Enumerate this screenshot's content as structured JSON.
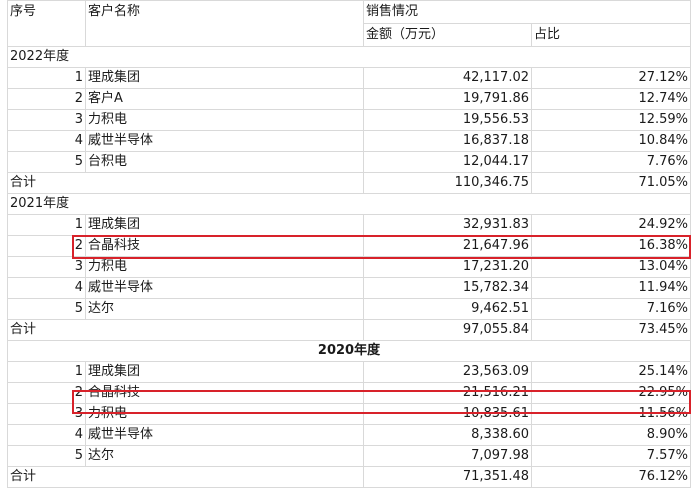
{
  "header": {
    "seq": "序号",
    "customer": "客户名称",
    "sales": "销售情况",
    "amount": "金额（万元）",
    "ratio": "占比"
  },
  "sections": [
    {
      "year": "2022年度",
      "rows": [
        {
          "no": "1",
          "name": "理成集团",
          "amount": "42,117.02",
          "ratio": "27.12%"
        },
        {
          "no": "2",
          "name": "客户A",
          "amount": "19,791.86",
          "ratio": "12.74%"
        },
        {
          "no": "3",
          "name": "力积电",
          "amount": "19,556.53",
          "ratio": "12.59%"
        },
        {
          "no": "4",
          "name": "威世半导体",
          "amount": "16,837.18",
          "ratio": "10.84%"
        },
        {
          "no": "5",
          "name": "台积电",
          "amount": "12,044.17",
          "ratio": "7.76%"
        }
      ],
      "total": {
        "label": "合计",
        "amount": "110,346.75",
        "ratio": "71.05%"
      }
    },
    {
      "year": "2021年度",
      "rows": [
        {
          "no": "1",
          "name": "理成集团",
          "amount": "32,931.83",
          "ratio": "24.92%"
        },
        {
          "no": "2",
          "name": "合晶科技",
          "amount": "21,647.96",
          "ratio": "16.38%"
        },
        {
          "no": "3",
          "name": "力积电",
          "amount": "17,231.20",
          "ratio": "13.04%"
        },
        {
          "no": "4",
          "name": "威世半导体",
          "amount": "15,782.34",
          "ratio": "11.94%"
        },
        {
          "no": "5",
          "name": "达尔",
          "amount": "9,462.51",
          "ratio": "7.16%"
        }
      ],
      "total": {
        "label": "合计",
        "amount": "97,055.84",
        "ratio": "73.45%"
      }
    },
    {
      "year": "2020年度",
      "rows": [
        {
          "no": "1",
          "name": "理成集团",
          "amount": "23,563.09",
          "ratio": "25.14%"
        },
        {
          "no": "2",
          "name": "合晶科技",
          "amount": "21,516.21",
          "ratio": "22.95%"
        },
        {
          "no": "3",
          "name": "力积电",
          "amount": "10,835.61",
          "ratio": "11.56%"
        },
        {
          "no": "4",
          "name": "威世半导体",
          "amount": "8,338.60",
          "ratio": "8.90%"
        },
        {
          "no": "5",
          "name": "达尔",
          "amount": "7,097.98",
          "ratio": "7.57%"
        }
      ],
      "total": {
        "label": "合计",
        "amount": "71,351.48",
        "ratio": "76.12%"
      }
    }
  ],
  "colors": {
    "highlight": "#d8222a",
    "grid": "#d9d9d9"
  }
}
